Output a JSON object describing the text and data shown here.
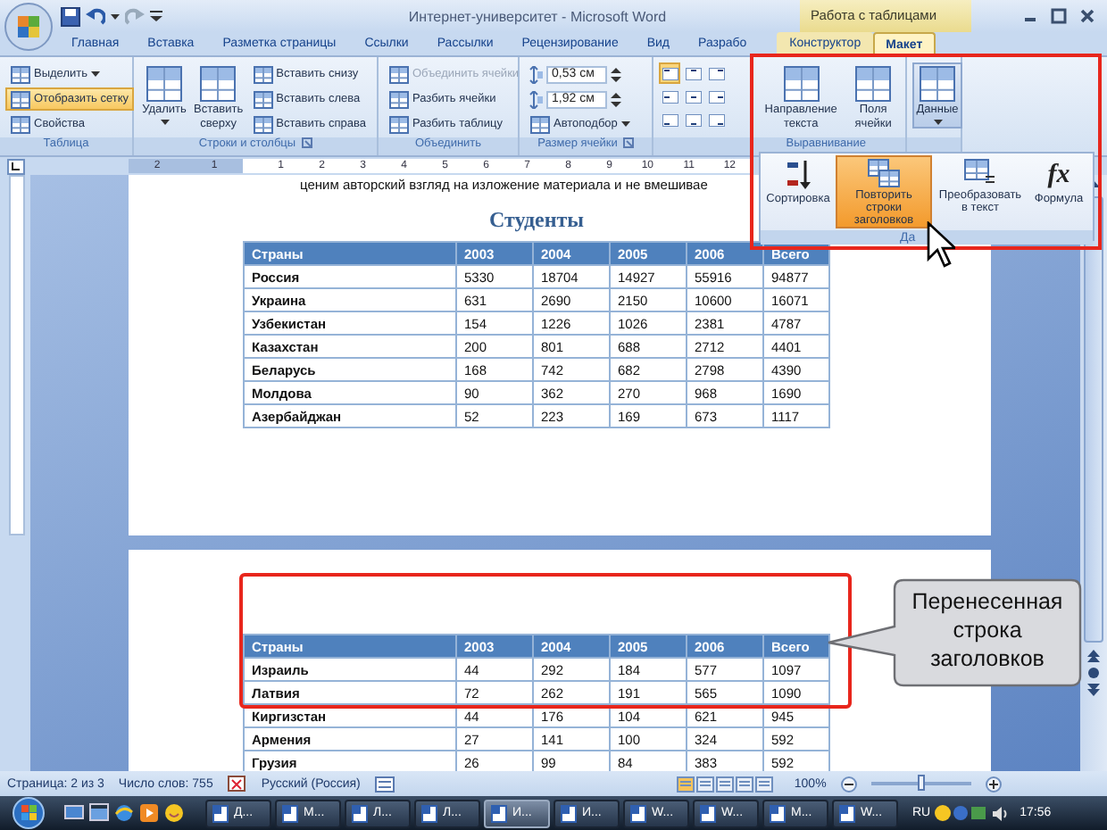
{
  "window": {
    "title": "Интернет-университет - Microsoft Word",
    "context_title": "Работа с таблицами"
  },
  "tabs": [
    {
      "label": "Главная",
      "selected": false,
      "contextual": false
    },
    {
      "label": "Вставка",
      "selected": false,
      "contextual": false
    },
    {
      "label": "Разметка страницы",
      "selected": false,
      "contextual": false
    },
    {
      "label": "Ссылки",
      "selected": false,
      "contextual": false
    },
    {
      "label": "Рассылки",
      "selected": false,
      "contextual": false
    },
    {
      "label": "Рецензирование",
      "selected": false,
      "contextual": false
    },
    {
      "label": "Вид",
      "selected": false,
      "contextual": false
    },
    {
      "label": "Разрабо",
      "selected": false,
      "contextual": false
    },
    {
      "label": "Конструктор",
      "selected": false,
      "contextual": true
    },
    {
      "label": "Макет",
      "selected": true,
      "contextual": true
    }
  ],
  "ribbon": {
    "groups": [
      {
        "label": "Таблица",
        "launcher": false,
        "items": [
          {
            "kind": "small",
            "label": "Выделить",
            "dropdown": true,
            "selected": false,
            "disabled": false
          },
          {
            "kind": "small",
            "label": "Отобразить сетку",
            "dropdown": false,
            "selected": true,
            "disabled": false
          },
          {
            "kind": "small",
            "label": "Свойства",
            "dropdown": false,
            "selected": false,
            "disabled": false
          }
        ]
      },
      {
        "label": "Строки и столбцы",
        "launcher": true,
        "items": [
          {
            "kind": "large",
            "label": "Удалить",
            "dropdown": true,
            "expanded": false
          },
          {
            "kind": "large",
            "label": "Вставить сверху",
            "dropdown": false,
            "expanded": false
          },
          {
            "kind": "small",
            "label": "Вставить снизу",
            "dropdown": false,
            "selected": false,
            "disabled": false
          },
          {
            "kind": "small",
            "label": "Вставить слева",
            "dropdown": false,
            "selected": false,
            "disabled": false
          },
          {
            "kind": "small",
            "label": "Вставить справа",
            "dropdown": false,
            "selected": false,
            "disabled": false
          }
        ]
      },
      {
        "label": "Объединить",
        "launcher": false,
        "items": [
          {
            "kind": "small",
            "label": "Объединить ячейки",
            "dropdown": false,
            "selected": false,
            "disabled": true
          },
          {
            "kind": "small",
            "label": "Разбить ячейки",
            "dropdown": false,
            "selected": false,
            "disabled": false
          },
          {
            "kind": "small",
            "label": "Разбить таблицу",
            "dropdown": false,
            "selected": false,
            "disabled": false
          }
        ]
      },
      {
        "label": "Размер ячейки",
        "launcher": true,
        "items": [
          {
            "kind": "spin",
            "value": "0,53 см"
          },
          {
            "kind": "spin",
            "value": "1,92 см"
          },
          {
            "kind": "small",
            "label": "Автоподбор",
            "dropdown": true,
            "selected": false,
            "disabled": false
          }
        ]
      },
      {
        "label": "Выравнивание",
        "launcher": false,
        "items": [
          {
            "kind": "align-grid",
            "cells": [
              {
                "selected": true
              },
              {
                "selected": false
              },
              {
                "selected": false
              },
              {
                "selected": false
              },
              {
                "selected": false
              },
              {
                "selected": false
              },
              {
                "selected": false
              },
              {
                "selected": false
              },
              {
                "selected": false
              }
            ]
          },
          {
            "kind": "large",
            "label": "Направление текста",
            "dropdown": false,
            "expanded": false
          },
          {
            "kind": "large",
            "label": "Поля ячейки",
            "dropdown": false,
            "expanded": false
          }
        ]
      },
      {
        "launcher": false,
        "items": [
          {
            "kind": "large",
            "label": "Данные",
            "dropdown": true,
            "expanded": true
          }
        ]
      }
    ]
  },
  "data_menu": {
    "group_label": "Да",
    "items": [
      {
        "kind": "sort",
        "label": "Сортировка",
        "selected": false
      },
      {
        "kind": "repeat",
        "label": "Повторить строки заголовков",
        "selected": true
      },
      {
        "kind": "convert",
        "label": "Преобразовать в текст",
        "selected": false
      },
      {
        "kind": "formula",
        "label": "Формула",
        "icon_text": "fx",
        "selected": false
      }
    ]
  },
  "ruler": {
    "left_numbers": [
      "2",
      "1"
    ],
    "numbers": [
      "1",
      "2",
      "3",
      "4",
      "5",
      "6",
      "7",
      "8",
      "9",
      "10",
      "11",
      "12"
    ]
  },
  "pages": [
    {
      "text": "ценим авторский взгляд на изложение материала и не вмешивае",
      "heading": "Студенты",
      "highlighted": false,
      "table": {
        "columns": [
          "Страны",
          "2003",
          "2004",
          "2005",
          "2006",
          "Всего"
        ],
        "rows": [
          [
            "Россия",
            "5330",
            "18704",
            "14927",
            "55916",
            "94877"
          ],
          [
            "Украина",
            "631",
            "2690",
            "2150",
            "10600",
            "16071"
          ],
          [
            "Узбекистан",
            "154",
            "1226",
            "1026",
            "2381",
            "4787"
          ],
          [
            "Казахстан",
            "200",
            "801",
            "688",
            "2712",
            "4401"
          ],
          [
            "Беларусь",
            "168",
            "742",
            "682",
            "2798",
            "4390"
          ],
          [
            "Молдова",
            "90",
            "362",
            "270",
            "968",
            "1690"
          ],
          [
            "Азербайджан",
            "52",
            "223",
            "169",
            "673",
            "1117"
          ]
        ]
      }
    },
    {
      "highlighted": true,
      "table": {
        "columns": [
          "Страны",
          "2003",
          "2004",
          "2005",
          "2006",
          "Всего"
        ],
        "rows": [
          [
            "Израиль",
            "44",
            "292",
            "184",
            "577",
            "1097"
          ],
          [
            "Латвия",
            "72",
            "262",
            "191",
            "565",
            "1090"
          ],
          [
            "Киргизстан",
            "44",
            "176",
            "104",
            "621",
            "945"
          ],
          [
            "Армения",
            "27",
            "141",
            "100",
            "324",
            "592"
          ],
          [
            "Грузия",
            "26",
            "99",
            "84",
            "383",
            "592"
          ]
        ]
      }
    }
  ],
  "callout": {
    "text": "Перенесенная строка заголовков"
  },
  "status_bar": {
    "page": "Страница: 2 из 3",
    "words": "Число слов: 755",
    "language": "Русский (Россия)",
    "zoom": "100%",
    "zoom_slider": {
      "level": 0.5
    }
  },
  "taskbar": {
    "buttons": [
      {
        "label": "Д...",
        "active": false
      },
      {
        "label": "М...",
        "active": false
      },
      {
        "label": "Л...",
        "active": false
      },
      {
        "label": "Л...",
        "active": false
      },
      {
        "label": "И...",
        "active": true
      },
      {
        "label": "И...",
        "active": false
      },
      {
        "label": "W...",
        "active": false
      },
      {
        "label": "W...",
        "active": false
      },
      {
        "label": "M...",
        "active": false
      },
      {
        "label": "W...",
        "active": false
      }
    ],
    "language": "RU",
    "clock": "17:56"
  }
}
